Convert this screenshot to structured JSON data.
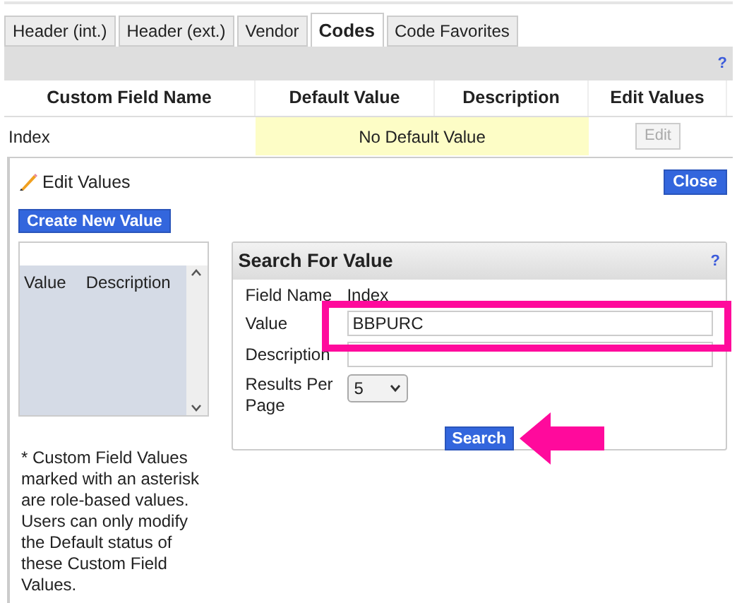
{
  "tabs": [
    {
      "label": "Header (int.)",
      "selected": false
    },
    {
      "label": "Header (ext.)",
      "selected": false
    },
    {
      "label": "Vendor",
      "selected": false
    },
    {
      "label": "Codes",
      "selected": true
    },
    {
      "label": "Code Favorites",
      "selected": false
    }
  ],
  "toolbar": {
    "help": "?"
  },
  "table": {
    "columns": [
      "Custom Field Name",
      "Default Value",
      "Description",
      "Edit Values"
    ],
    "rows": [
      {
        "custom_field_name": "Index",
        "default_value": "No Default Value",
        "edit_button": {
          "label": "Edit",
          "disabled": true
        }
      }
    ]
  },
  "edit_panel": {
    "title": "Edit Values",
    "close_button": "Close",
    "create_button": "Create New Value",
    "list": {
      "columns": [
        "Value",
        "Description"
      ]
    },
    "note": "* Custom Field Values marked with an asterisk are role-based values. Users can only modify the Default status of these Custom Field Values.",
    "search": {
      "title": "Search For Value",
      "help": "?",
      "fields": [
        {
          "kind": "text",
          "label": "Field Name",
          "value": "Index"
        },
        {
          "kind": "input",
          "label": "Value",
          "value": "BBPURC"
        },
        {
          "kind": "input",
          "label": "Description"
        },
        {
          "kind": "select",
          "label": "Results Per Page",
          "value": "5"
        }
      ],
      "button": "Search"
    }
  }
}
